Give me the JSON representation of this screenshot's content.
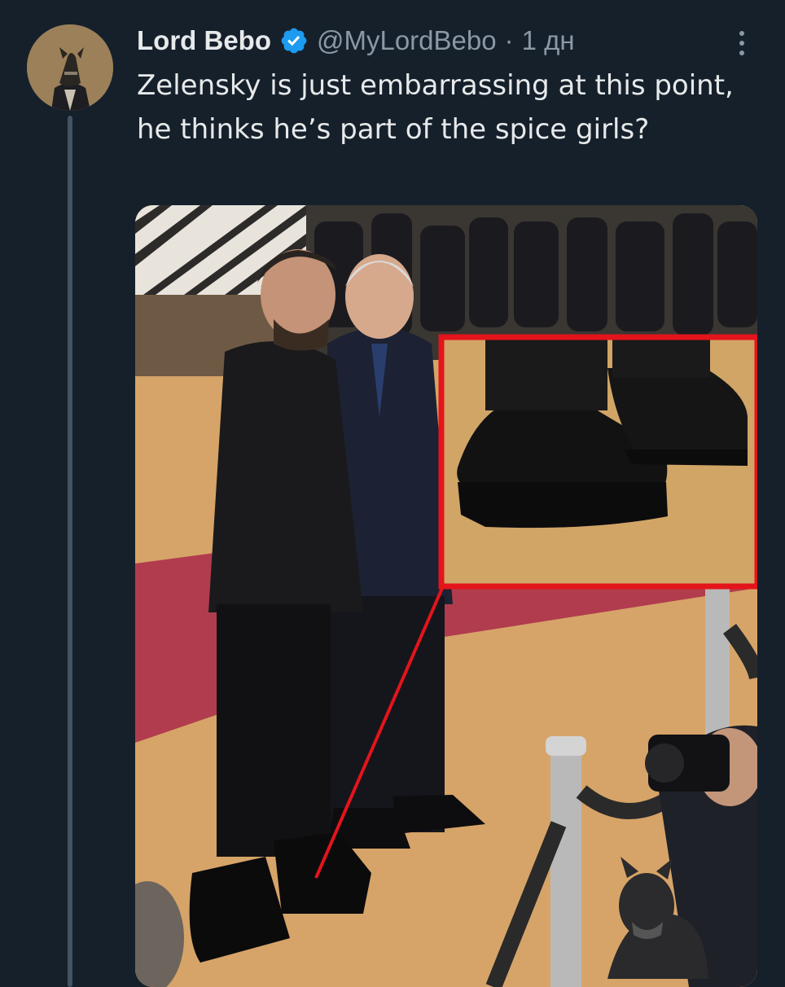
{
  "tweet": {
    "author_name": "Lord Bebo",
    "handle": "@MyLordBebo",
    "separator": "·",
    "time": "1 дн",
    "verified_icon": "verified-badge-icon",
    "more_icon": "more-vertical-icon",
    "text": "Zelensky is just embarrassing at this point, he thinks he’s part of the spice girls?"
  },
  "media": {
    "description_icon": "photo",
    "accent_colors": {
      "highlight_box": "#e4141b",
      "carpet": "#b13c4e",
      "floor": "#d6a468"
    }
  },
  "colors": {
    "background": "#15202b",
    "text_primary": "#e7e9ea",
    "text_secondary": "#8b98a5",
    "verified": "#1d9bf0",
    "thread_line": "#425364"
  }
}
